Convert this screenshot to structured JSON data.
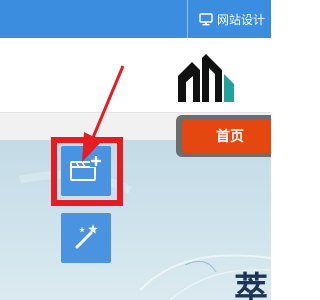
{
  "topbar": {
    "link_label": "网站设计",
    "icon": "monitor-icon"
  },
  "logo": {
    "icon": "brand-logo"
  },
  "nav": {
    "home_label": "首页",
    "tab_color": "#e4470f"
  },
  "toolbar": {
    "add_module_icon": "add-window-icon",
    "magic_icon": "magic-wand-icon"
  },
  "annotation": {
    "highlight_color": "#e31d22",
    "arrow_color": "#e31d22"
  },
  "banner": {
    "partial_text": "萃"
  },
  "colors": {
    "accent": "#3b8de0",
    "button": "#4a93e0"
  }
}
